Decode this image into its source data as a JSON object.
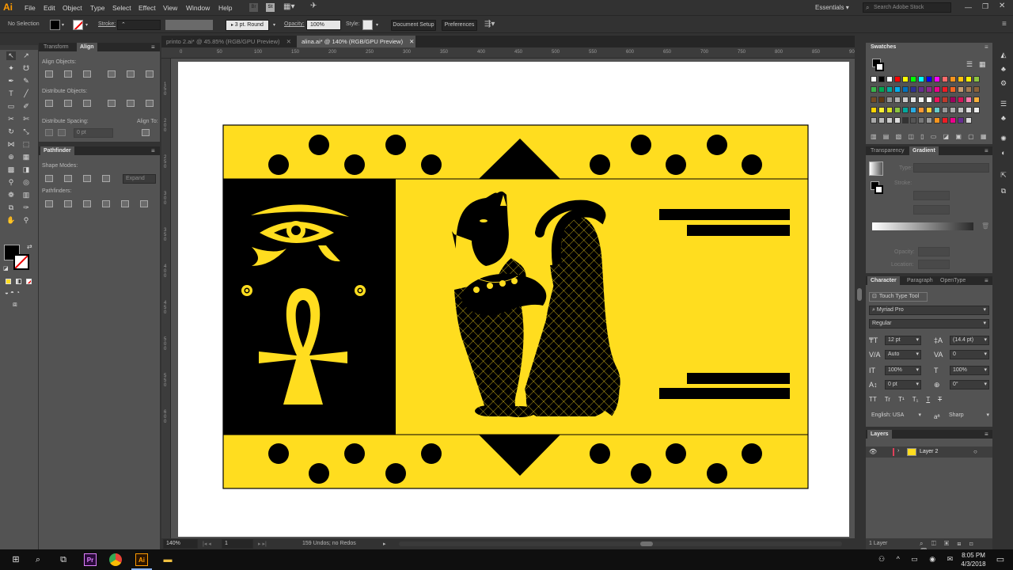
{
  "app": {
    "logo": "Ai"
  },
  "menu": [
    "File",
    "Edit",
    "Object",
    "Type",
    "Select",
    "Effect",
    "View",
    "Window",
    "Help"
  ],
  "menu_right": {
    "workspace": "Essentials",
    "search_placeholder": "Search Adobe Stock",
    "st_badge": "St",
    "br_badge": "Br"
  },
  "control_bar": {
    "selection": "No Selection",
    "stroke_label": "Stroke:",
    "brush": "3 pt. Round",
    "opacity_label": "Opacity:",
    "opacity_value": "100%",
    "style_label": "Style:",
    "document_setup": "Document Setup",
    "preferences": "Preferences"
  },
  "doc_tabs": [
    {
      "label": "printo 2.ai* @ 45.85% (RGB/GPU Preview)",
      "active": false
    },
    {
      "label": "alina.ai* @ 140% (RGB/GPU Preview)",
      "active": true
    }
  ],
  "ruler_top": [
    "0",
    "50",
    "100",
    "150",
    "200",
    "250",
    "300",
    "350",
    "400",
    "450",
    "500",
    "550",
    "600",
    "650",
    "700",
    "750",
    "800",
    "850",
    "900"
  ],
  "ruler_left": [
    "1",
    "5",
    "0",
    "2",
    "0",
    "0",
    "2",
    "5",
    "0",
    "3",
    "0",
    "0",
    "3",
    "5",
    "0",
    "4",
    "0",
    "0",
    "4",
    "5",
    "0",
    "5",
    "0",
    "0",
    "5",
    "5",
    "0",
    "6",
    "0",
    "0"
  ],
  "align_panel": {
    "tabs": [
      "Transform",
      "Align"
    ],
    "align_objects": "Align Objects:",
    "distribute_objects": "Distribute Objects:",
    "distribute_spacing": "Distribute Spacing:",
    "align_to": "Align To:",
    "spacing_value": "0 pt"
  },
  "pathfinder_panel": {
    "tab": "Pathfinder",
    "shape_modes": "Shape Modes:",
    "pathfinders": "Pathfinders:",
    "expand": "Expand"
  },
  "swatches_panel": {
    "title": "Swatches",
    "colors": [
      "#ffffff",
      "#000000",
      "#ffffff",
      "#ff0000",
      "#ffff00",
      "#00ff00",
      "#00ffff",
      "#0000ff",
      "#ff00ff",
      "#ff6a6a",
      "#f7941d",
      "#ffc20e",
      "#fff200",
      "#8dc63f",
      "#39b54a",
      "#00a651",
      "#00a99d",
      "#00aeef",
      "#0072bc",
      "#2e3192",
      "#662d91",
      "#92278f",
      "#ec008c",
      "#ed1c24",
      "#f26522",
      "#c69c6d",
      "#a67c52",
      "#8c6239",
      "#754c24",
      "#603913",
      "#959595",
      "#b3b3b3",
      "#ccc",
      "#e6e6e6",
      "#f2f2f2",
      "#ffffff",
      "#ed145b",
      "#c0392b",
      "#9e005d",
      "#d4145a",
      "#ff7bac",
      "#fbb03b",
      "#ffd400",
      "#f9ed32",
      "#d9e021",
      "#8cc63f",
      "#00a99d",
      "#29abe2",
      "#ff9933",
      "#ffcc33",
      "#66cccc",
      "#999999",
      "#b0b0b0",
      "#c6c6c6",
      "#dddddd",
      "#eeeeee",
      "#aaaaaa",
      "#bbbbbb",
      "#cccccc",
      "#dddddd",
      "#333333",
      "#555555",
      "#777777",
      "#999999",
      "#f7941d",
      "#ed1c24",
      "#ec008c",
      "#662d91",
      "#d8d8d8"
    ]
  },
  "gradient_panel": {
    "tabs": [
      "Transparency",
      "Gradient"
    ],
    "type_label": "Type:",
    "stroke_label": "Stroke:",
    "opacity_label": "Opacity:",
    "location_label": "Location:"
  },
  "character_panel": {
    "tabs": [
      "Character",
      "Paragraph",
      "OpenType"
    ],
    "touch_type": "Touch Type Tool",
    "font_family": "Myriad Pro",
    "font_style": "Regular",
    "size": "12 pt",
    "leading": "(14.4 pt)",
    "kerning": "Auto",
    "tracking": "0",
    "vscale": "100%",
    "hscale": "100%",
    "baseline": "0 pt",
    "rotation": "0°",
    "lang": "English: USA",
    "aa": "Sharp",
    "aa_prefix": "aª",
    "tt_buttons": [
      "TT",
      "Tr",
      "T¹",
      "T₁",
      "T",
      "T"
    ]
  },
  "layers_panel": {
    "title": "Layers",
    "layer_name": "Layer 2",
    "footer": "1 Layer"
  },
  "status_bar": {
    "zoom": "140%",
    "artboard": "1",
    "status": "159 Undos; no Redos"
  },
  "taskbar": {
    "time": "8:05 PM",
    "date": "4/3/2018",
    "pr": "Pr",
    "ai": "Ai"
  },
  "artwork_colors": {
    "yellow": "#ffdd1f",
    "black": "#000000"
  }
}
